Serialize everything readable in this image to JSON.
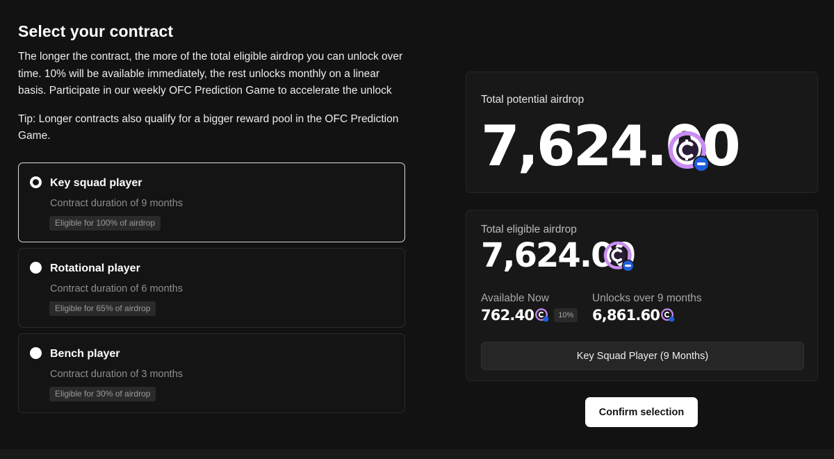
{
  "header": {
    "title": "Select your contract",
    "description": "The longer the contract, the more of the total eligible airdrop you can unlock over time. 10% will be available immediately, the rest unlocks monthly on a linear basis. Participate in our weekly OFC Prediction Game to accelerate the unlock",
    "tip": "Tip: Longer contracts also qualify for a bigger reward pool in the OFC Prediction Game."
  },
  "options": [
    {
      "title": "Key squad player",
      "duration": "Contract duration of 9 months",
      "badge": "Eligible for 100% of airdrop",
      "selected": true
    },
    {
      "title": "Rotational player",
      "duration": "Contract duration of 6 months",
      "badge": "Eligible for 65% of airdrop",
      "selected": false
    },
    {
      "title": "Bench player",
      "duration": "Contract duration of 3 months",
      "badge": "Eligible for 30% of airdrop",
      "selected": false
    }
  ],
  "potential": {
    "label": "Total potential airdrop",
    "amount": "7,624.00"
  },
  "eligible": {
    "label": "Total eligible airdrop",
    "amount": "7,624.00",
    "available_label": "Available Now",
    "available_amount": "762.40",
    "available_pct": "10%",
    "unlock_label": "Unlocks over 9 months",
    "unlock_amount": "6,861.60",
    "contract_label": "Key Squad Player (9 Months)"
  },
  "confirm_label": "Confirm selection",
  "icons": {
    "coin": "ofc-coin-icon",
    "radio": "radio-icon"
  },
  "colors": {
    "coin_ring": "#c98cf2",
    "coin_badge": "#1f5fdc",
    "background": "#121212"
  }
}
